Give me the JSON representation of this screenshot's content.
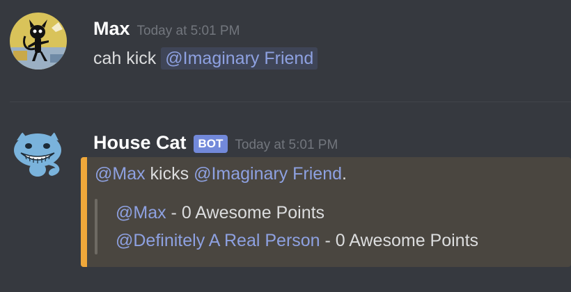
{
  "messages": [
    {
      "author": "Max",
      "timestamp": "Today at 5:01 PM",
      "avatar_icon": "black-cat-character-avatar-icon",
      "text_before": "cah kick ",
      "mention": "@Imaginary Friend"
    },
    {
      "author": "House Cat",
      "bot_tag": "BOT",
      "timestamp": "Today at 5:01 PM",
      "avatar_icon": "grinning-blue-cat-avatar-icon",
      "embed": {
        "accent_color": "#f0a83a",
        "line1_mention1": "@Max",
        "line1_text": " kicks ",
        "line1_mention2": "@Imaginary Friend",
        "line1_end": ".",
        "quote": [
          {
            "mention": "@Max",
            "text": " - 0 Awesome Points"
          },
          {
            "mention": "@Definitely A Real Person",
            "text": " - 0 Awesome Points"
          }
        ]
      }
    }
  ],
  "colors": {
    "background": "#36393f",
    "mention": "#8ea1e1",
    "bot_tag": "#7289da",
    "embed_background": "#4a4640"
  }
}
